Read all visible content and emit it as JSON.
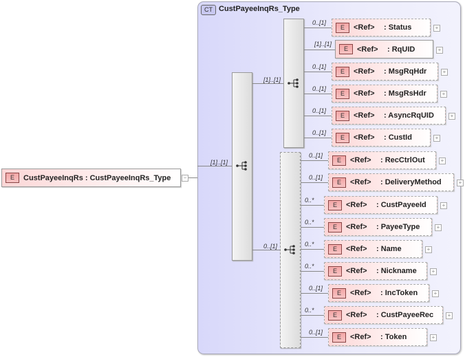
{
  "root": {
    "badge": "E",
    "name": "CustPayeeInqRs",
    "type": ": CustPayeeInqRs_Type",
    "expander": "−"
  },
  "complex_type": {
    "badge": "CT",
    "title": "CustPayeeInqRs_Type"
  },
  "outer_sequence": {
    "cardinality": "[1]..[1]"
  },
  "first_sequence": {
    "cardinality": "[1]..[1]"
  },
  "second_group": {
    "cardinality": "0..[1]"
  },
  "first_children": [
    {
      "cardinality": "0..[1]",
      "ref": "<Ref>",
      "name": ": Status",
      "optional": true
    },
    {
      "cardinality": "[1]..[1]",
      "ref": "<Ref>",
      "name": ": RqUID",
      "optional": false
    },
    {
      "cardinality": "0..[1]",
      "ref": "<Ref>",
      "name": ": MsgRqHdr",
      "optional": true
    },
    {
      "cardinality": "0..[1]",
      "ref": "<Ref>",
      "name": ": MsgRsHdr",
      "optional": true
    },
    {
      "cardinality": "0..[1]",
      "ref": "<Ref>",
      "name": ": AsyncRqUID",
      "optional": true
    },
    {
      "cardinality": "0..[1]",
      "ref": "<Ref>",
      "name": ": CustId",
      "optional": true
    }
  ],
  "second_children": [
    {
      "cardinality": "0..[1]",
      "ref": "<Ref>",
      "name": ": RecCtrlOut",
      "optional": true
    },
    {
      "cardinality": "0..[1]",
      "ref": "<Ref>",
      "name": ": DeliveryMethod",
      "optional": true
    },
    {
      "cardinality": "0..*",
      "ref": "<Ref>",
      "name": ": CustPayeeId",
      "optional": true
    },
    {
      "cardinality": "0..*",
      "ref": "<Ref>",
      "name": ": PayeeType",
      "optional": true
    },
    {
      "cardinality": "0..*",
      "ref": "<Ref>",
      "name": ": Name",
      "optional": true
    },
    {
      "cardinality": "0..*",
      "ref": "<Ref>",
      "name": ": Nickname",
      "optional": true
    },
    {
      "cardinality": "0..[1]",
      "ref": "<Ref>",
      "name": ": IncToken",
      "optional": true
    },
    {
      "cardinality": "0..*",
      "ref": "<Ref>",
      "name": ": CustPayeeRec",
      "optional": true
    },
    {
      "cardinality": "0..[1]",
      "ref": "<Ref>",
      "name": ": Token",
      "optional": true
    }
  ]
}
